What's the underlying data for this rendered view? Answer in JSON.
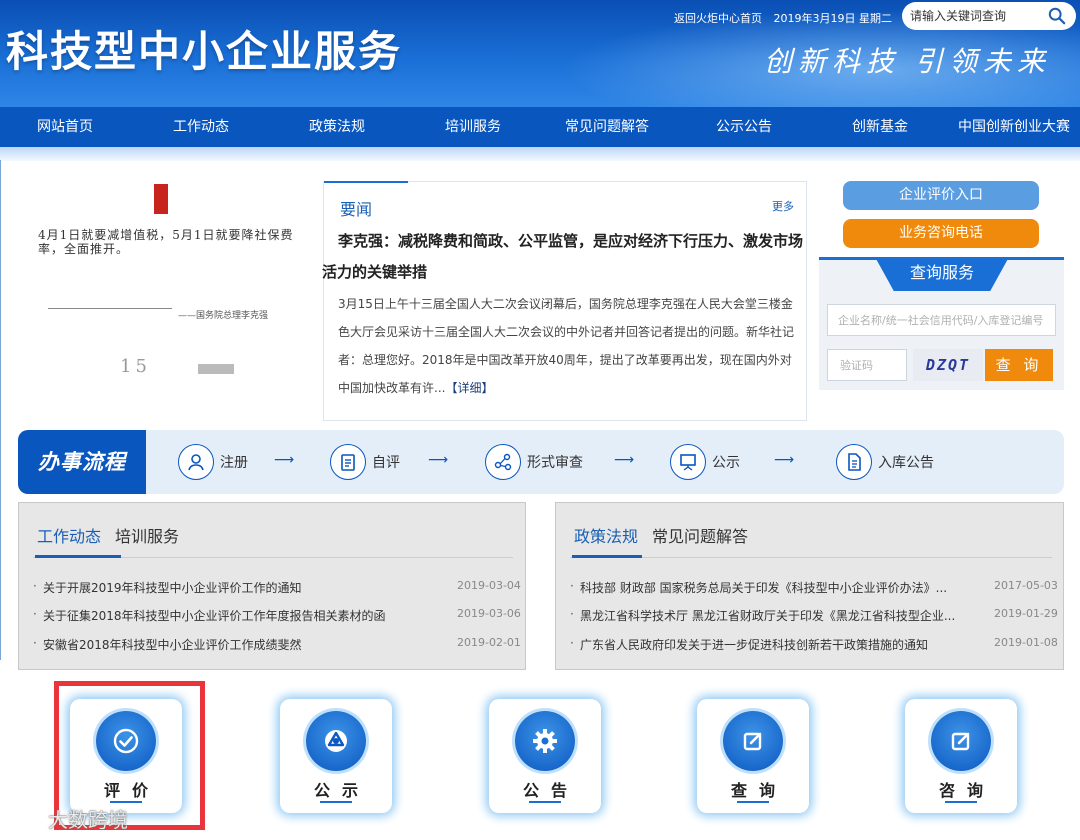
{
  "header": {
    "site_title": "科技型中小企业服务",
    "slogan": "创新科技 引领未来",
    "top_link_home": "返回火炬中心首页",
    "top_date": "2019年3月19日 星期二",
    "search_placeholder": "请输入关键词查询"
  },
  "nav": {
    "items": [
      "网站首页",
      "工作动态",
      "政策法规",
      "培训服务",
      "常见问题解答",
      "公示公告",
      "创新基金",
      "中国创新创业大赛"
    ]
  },
  "news_image": {
    "quote": "4月1日就要减增值税，5月1日就要降社保费率，全面推开。",
    "signature": "——国务院总理李克强",
    "date_number": "15"
  },
  "news": {
    "tab_label": "要闻",
    "more_label": "更多",
    "headline": "李克强：减税降费和简政、公平监管，是应对经济下行压力、激发市场活力的关键举措",
    "body": "3月15日上午十三届全国人大二次会议闭幕后，国务院总理李克强在人民大会堂三楼金色大厅会见采访十三届全国人大二次会议的中外记者并回答记者提出的问题。新华社记者：总理您好。2018年是中国改革开放40周年，提出了改革要再出发，现在国内外对中国加快改革有许...",
    "detail_label": "【详细】"
  },
  "side": {
    "eval_entry": "企业评价入口",
    "consult_phone": "业务咨询电话",
    "query_title": "查询服务",
    "query_placeholder": "企业名称/统一社会信用代码/入库登记编号",
    "captcha_placeholder": "验证码",
    "captcha_code": "DZQT",
    "query_button": "查 询"
  },
  "process": {
    "title": "办事流程",
    "steps": [
      "注册",
      "自评",
      "形式审查",
      "公示",
      "入库公告"
    ],
    "arrow": "⟶"
  },
  "panel_left": {
    "tab_active": "工作动态",
    "tab_inactive": "培训服务",
    "rows": [
      {
        "title": "关于开展2019年科技型中小企业评价工作的通知",
        "date": "2019-03-04"
      },
      {
        "title": "关于征集2018年科技型中小企业评价工作年度报告相关素材的函",
        "date": "2019-03-06"
      },
      {
        "title": "安徽省2018年科技型中小企业评价工作成绩斐然",
        "date": "2019-02-01"
      }
    ]
  },
  "panel_right": {
    "tab_active": "政策法规",
    "tab_inactive": "常见问题解答",
    "rows": [
      {
        "title": "科技部 财政部 国家税务总局关于印发《科技型中小企业评价办法》...",
        "date": "2017-05-03"
      },
      {
        "title": "黑龙江省科学技术厅 黑龙江省财政厅关于印发《黑龙江省科技型企业...",
        "date": "2019-01-29"
      },
      {
        "title": "广东省人民政府印发关于进一步促进科技创新若干政策措施的通知",
        "date": "2019-01-08"
      }
    ]
  },
  "tiles": [
    {
      "label": "评价",
      "icon": "check-circle-icon"
    },
    {
      "label": "公示",
      "icon": "triangle-circle-icon"
    },
    {
      "label": "公告",
      "icon": "gear-icon"
    },
    {
      "label": "查询",
      "icon": "edit-icon"
    },
    {
      "label": "咨询",
      "icon": "edit-icon"
    }
  ],
  "watermark": "大数跨境",
  "colors": {
    "brand_blue": "#0a56bf",
    "accent_orange": "#f08a0c",
    "highlight_red": "#e8343a"
  }
}
